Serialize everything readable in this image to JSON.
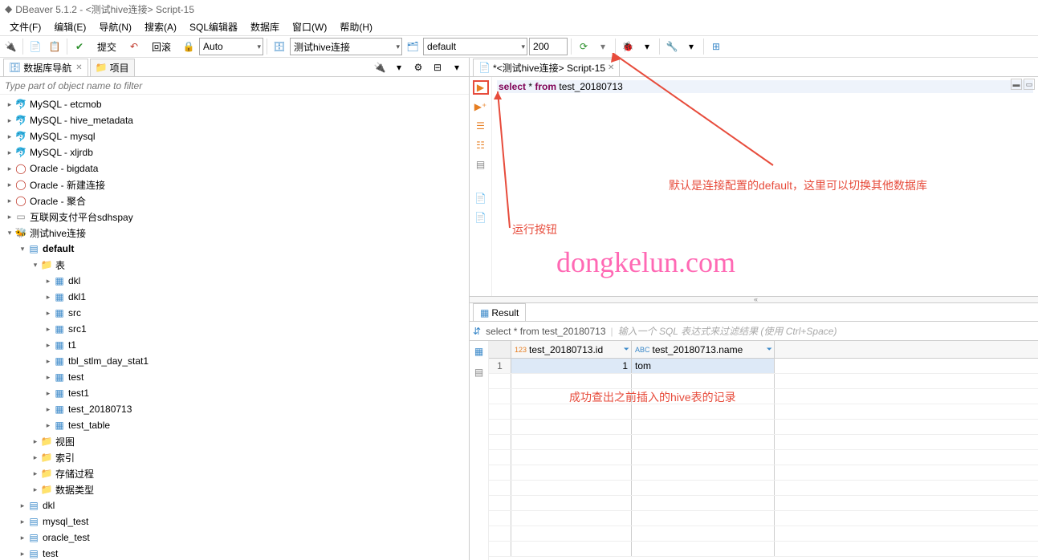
{
  "window": {
    "title": "DBeaver 5.1.2 - <测试hive连接> Script-15"
  },
  "menu": {
    "file": "文件(F)",
    "edit": "编辑(E)",
    "navigate": "导航(N)",
    "search": "搜索(A)",
    "sql": "SQL编辑器",
    "database": "数据库",
    "window": "窗口(W)",
    "help": "帮助(H)"
  },
  "toolbar": {
    "commit": "提交",
    "rollback": "回滚",
    "auto": "Auto",
    "connection": "测试hive连接",
    "schema": "default",
    "limit": "200"
  },
  "left": {
    "tab_db_nav": "数据库导航",
    "tab_project": "项目",
    "filter_placeholder": "Type part of object name to filter"
  },
  "tree": {
    "n0": "MySQL - etcmob",
    "n1": "MySQL - hive_metadata",
    "n2": "MySQL - mysql",
    "n3": "MySQL - xljrdb",
    "n4": "Oracle - bigdata",
    "n5": "Oracle - 新建连接",
    "n6": "Oracle - 聚合",
    "n7": "互联网支付平台sdhspay",
    "n8": "测试hive连接",
    "n9": "default",
    "n10": "表",
    "t0": "dkl",
    "t1": "dkl1",
    "t2": "src",
    "t3": "src1",
    "t4": "t1",
    "t5": "tbl_stlm_day_stat1",
    "t6": "test",
    "t7": "test1",
    "t8": "test_20180713",
    "t9": "test_table",
    "f1": "视图",
    "f2": "索引",
    "f3": "存储过程",
    "f4": "数据类型",
    "b0": "dkl",
    "b1": "mysql_test",
    "b2": "oracle_test",
    "b3": "test"
  },
  "editor": {
    "tab_label": "*<测试hive连接> Script-15",
    "sql_kw1": "select",
    "sql_star": " * ",
    "sql_kw2": "from",
    "sql_rest": " test_20180713"
  },
  "annotations": {
    "run_button": "运行按钮",
    "schema_note": "默认是连接配置的default，这里可以切换其他数据库",
    "result_note": "成功查出之前插入的hive表的记录",
    "watermark": "dongkelun.com"
  },
  "result": {
    "tab_label": "Result",
    "query": "select * from test_20180713",
    "filter_hint": "输入一个 SQL 表达式来过滤结果 (使用 Ctrl+Space)",
    "col1_prefix": "123",
    "col1": "test_20180713.id",
    "col2_prefix": "ABC",
    "col2": "test_20180713.name",
    "row1_num": "1",
    "row1_id": "1",
    "row1_name": "tom"
  },
  "chart_data": {
    "type": "table",
    "columns": [
      "test_20180713.id",
      "test_20180713.name"
    ],
    "rows": [
      [
        1,
        "tom"
      ]
    ]
  }
}
